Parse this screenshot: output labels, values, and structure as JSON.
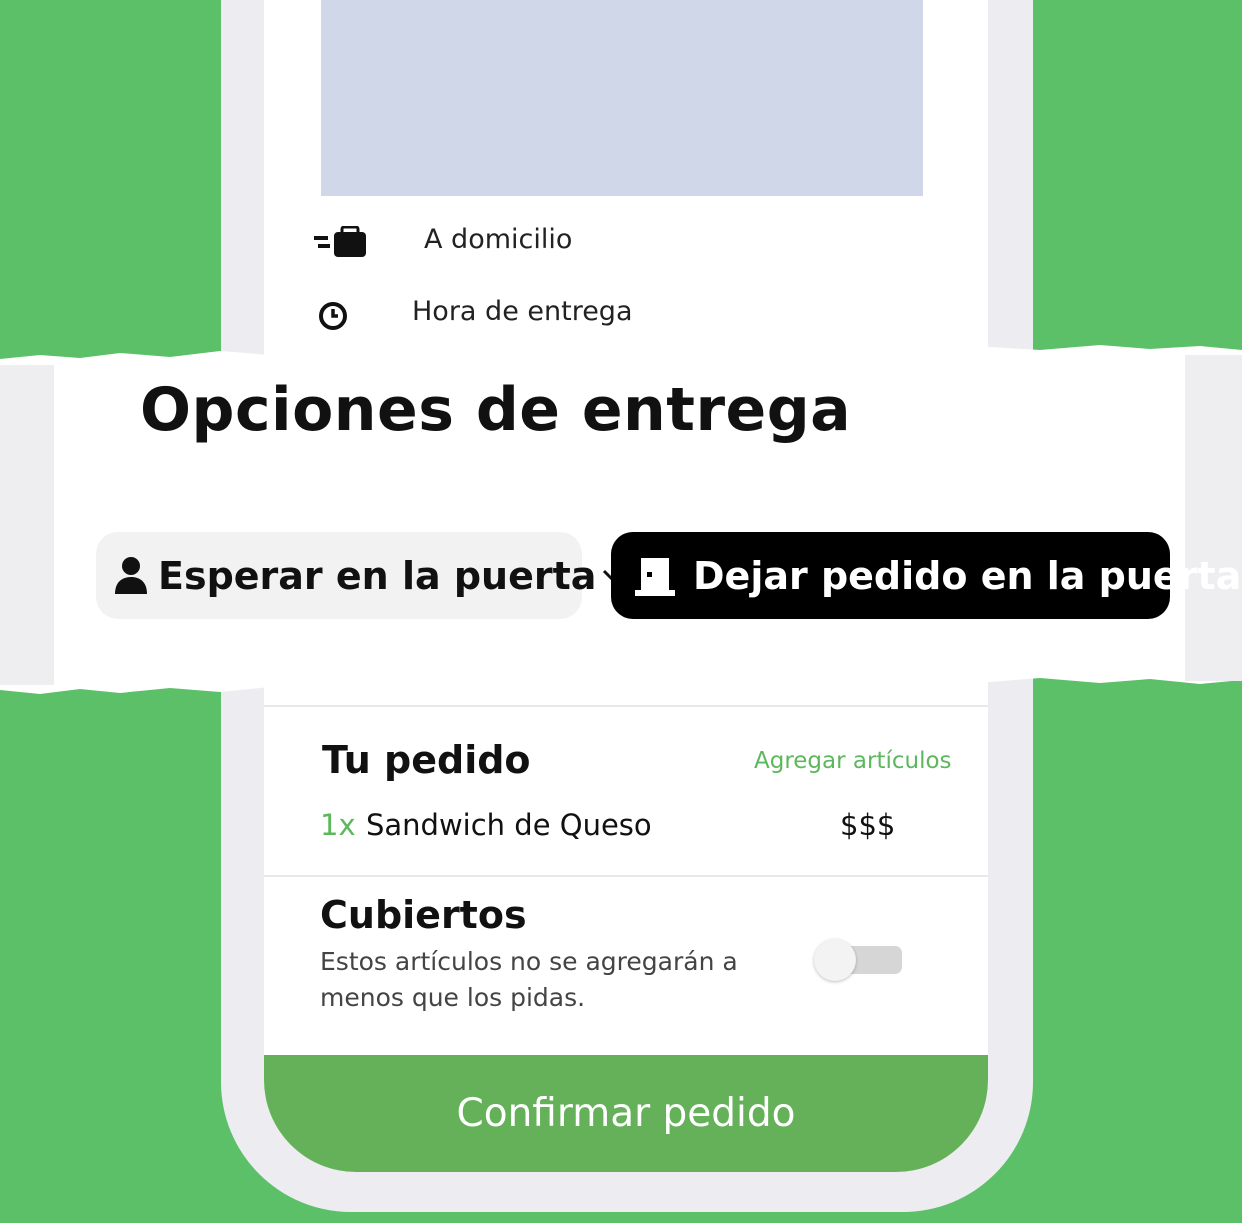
{
  "app": {
    "accent_color": "#5cc068",
    "button_color": "#64b159"
  },
  "delivery_rows": [
    {
      "icon": "delivery-bag-icon",
      "label": "A domicilio"
    },
    {
      "icon": "clock-icon",
      "label": "Hora de entrega"
    }
  ],
  "banner": {
    "title": "Opciones de entrega",
    "options": [
      {
        "icon": "person-icon",
        "label": "Esperar en la puerta",
        "selected": false,
        "has_dropdown": true
      },
      {
        "icon": "door-icon",
        "label": "Dejar pedido en la puerta",
        "selected": true
      }
    ]
  },
  "order": {
    "title": "Tu pedido",
    "add_items_label": "Agregar artículos",
    "items": [
      {
        "qty": "1x",
        "name": "Sandwich de Queso",
        "price": "$$$"
      }
    ]
  },
  "cutlery": {
    "title": "Cubiertos",
    "description": "Estos artículos no se agregarán a menos que los pidas.",
    "enabled": false
  },
  "confirm_button": {
    "label": "Confirmar pedido"
  }
}
